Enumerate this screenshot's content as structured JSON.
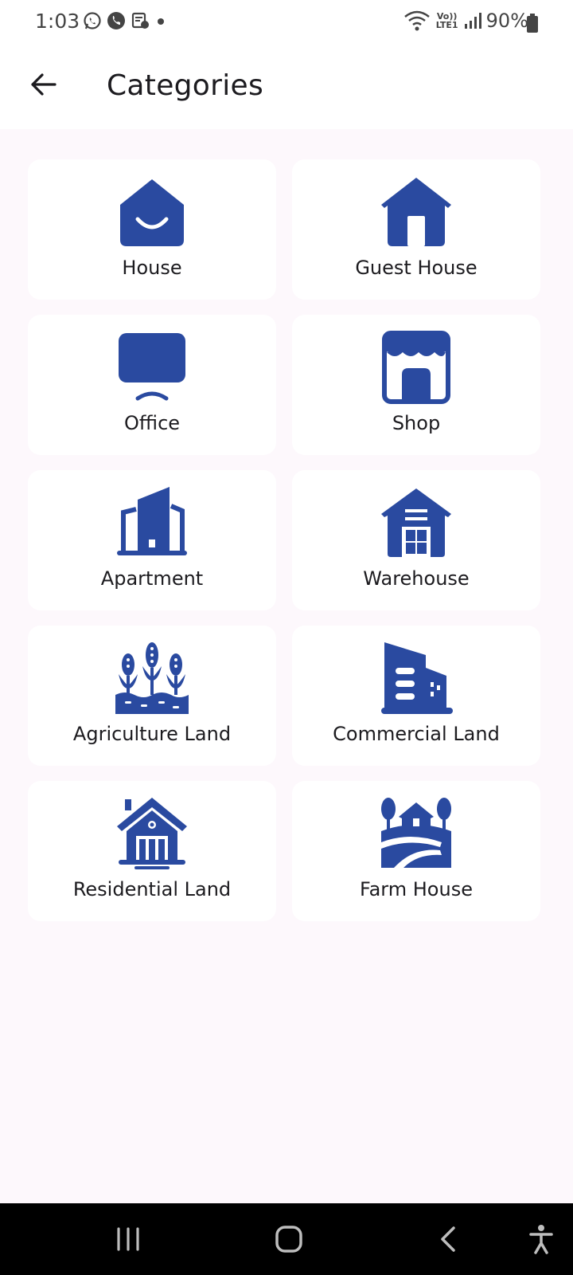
{
  "status_bar": {
    "time": "1:03",
    "battery": "90%",
    "network_label": "Vo)) LTE1"
  },
  "app_bar": {
    "title": "Categories",
    "back_icon": "arrow-left-icon"
  },
  "colors": {
    "accent": "#2a4aa0",
    "background": "#fdf8fc",
    "card": "#ffffff"
  },
  "categories": [
    {
      "label": "House",
      "icon": "house-smile-icon"
    },
    {
      "label": "Guest House",
      "icon": "guest-house-icon"
    },
    {
      "label": "Office",
      "icon": "office-monitor-icon"
    },
    {
      "label": "Shop",
      "icon": "shop-storefront-icon"
    },
    {
      "label": "Apartment",
      "icon": "apartment-buildings-icon"
    },
    {
      "label": "Warehouse",
      "icon": "warehouse-icon"
    },
    {
      "label": "Agriculture Land",
      "icon": "agriculture-crops-icon"
    },
    {
      "label": "Commercial Land",
      "icon": "commercial-building-icon"
    },
    {
      "label": "Residential Land",
      "icon": "residential-home-icon"
    },
    {
      "label": "Farm House",
      "icon": "farm-house-icon"
    }
  ],
  "nav_bar": {
    "items": [
      "recent-apps-icon",
      "home-icon",
      "back-icon",
      "accessibility-icon"
    ]
  }
}
